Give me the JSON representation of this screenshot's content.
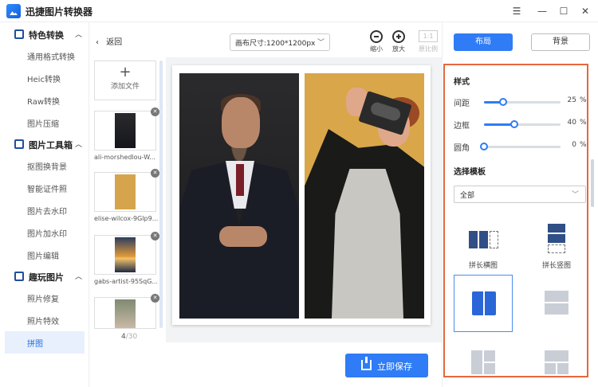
{
  "app": {
    "title": "迅捷图片转换器",
    "window_buttons": [
      "☰",
      "—",
      "☐",
      "✕"
    ]
  },
  "sidebar": {
    "groups": [
      {
        "label": "特色转换",
        "chevron": "︿",
        "items": [
          "通用格式转换",
          "Heic转换",
          "Raw转换",
          "图片压缩"
        ]
      },
      {
        "label": "图片工具箱",
        "chevron": "︿",
        "items": [
          "抠图换背景",
          "智能证件照",
          "图片去水印",
          "图片加水印",
          "图片编辑"
        ]
      },
      {
        "label": "趣玩图片",
        "chevron": "︿",
        "items": [
          "照片修复",
          "照片特效",
          "拼图"
        ]
      }
    ],
    "active_item": "拼图"
  },
  "toolbar": {
    "back_label": "返回",
    "canvas_size": "画布尺寸:1200*1200px",
    "zoom_out_label": "缩小",
    "zoom_in_label": "放大",
    "ratio_box": "1:1",
    "ratio_label": "原比例"
  },
  "files": {
    "add_label": "添加文件",
    "items": [
      {
        "name": "ali-morshedlou-W..."
      },
      {
        "name": "elise-wilcox-9Glp9..."
      },
      {
        "name": "gabs-artist-95SqG..."
      },
      {
        "name": ""
      }
    ],
    "page_current": "4",
    "page_total": "/30"
  },
  "save_button": "立即保存",
  "right_panel": {
    "tab_layout": "布局",
    "tab_background": "背景",
    "style_title": "样式",
    "sliders": [
      {
        "label": "间距",
        "value": 25,
        "unit": "%"
      },
      {
        "label": "边框",
        "value": 40,
        "unit": "%"
      },
      {
        "label": "圆角",
        "value": 0,
        "unit": "%"
      }
    ],
    "template_title": "选择模板",
    "template_filter": "全部",
    "templates": [
      {
        "label": "拼长横图"
      },
      {
        "label": "拼长竖图"
      }
    ]
  },
  "colors": {
    "accent": "#2f7cf6",
    "highlight_border": "#e8663c",
    "active_nav_bg": "#e8f0fe"
  }
}
